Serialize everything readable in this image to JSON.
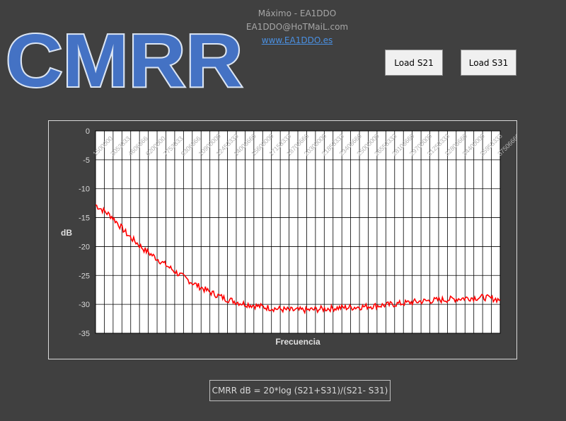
{
  "header": {
    "logo_text": "CMRR",
    "author": "Máximo - EA1DDO",
    "email": "EA1DDO@HoTMaiL.com",
    "website": "www.EA1DDO.es"
  },
  "buttons": {
    "load_s21": "Load S21",
    "load_s31": "Load S31"
  },
  "formula": "CMRR dB = 20*log (S21+S31)/(S21- S31)",
  "colors": {
    "background": "#404040",
    "series": "#ff0000",
    "logo_fill": "#4472c4"
  },
  "chart_data": {
    "type": "line",
    "title": "",
    "xlabel": "Frecuencia",
    "ylabel": "dB",
    "ylim": [
      -35,
      0
    ],
    "yticks": [
      0,
      -5,
      -10,
      -15,
      -20,
      -25,
      -30,
      -35
    ],
    "x_tick_labels": [
      "1500000",
      "3053333",
      "4606666",
      "6200000",
      "7753333",
      "9306666",
      "10900000",
      "12453333",
      "14006666",
      "15600000",
      "17153333",
      "18706666",
      "20300000",
      "21853333",
      "23406666",
      "25000000",
      "26553333",
      "28106666",
      "29700000",
      "31253333",
      "32806666",
      "34400000",
      "35953333",
      "37506666"
    ],
    "grid": true,
    "series": [
      {
        "name": "",
        "color": "#ff0000",
        "x": [
          1500000,
          3000000,
          4500000,
          6000000,
          7500000,
          9000000,
          10500000,
          12000000,
          13500000,
          15000000,
          16500000,
          18000000,
          19500000,
          21000000,
          22500000,
          24000000,
          25500000,
          27000000,
          28500000,
          30000000,
          31500000,
          33000000,
          34500000,
          36000000,
          37500000,
          39000000
        ],
        "values": [
          -12.8,
          -14.8,
          -18.0,
          -20.5,
          -22.5,
          -24.5,
          -26.3,
          -27.8,
          -29.0,
          -29.8,
          -30.3,
          -30.7,
          -31.0,
          -31.0,
          -30.8,
          -30.6,
          -30.5,
          -30.3,
          -30.1,
          -29.8,
          -29.5,
          -29.3,
          -29.1,
          -28.9,
          -28.8,
          -29.2
        ]
      }
    ]
  }
}
